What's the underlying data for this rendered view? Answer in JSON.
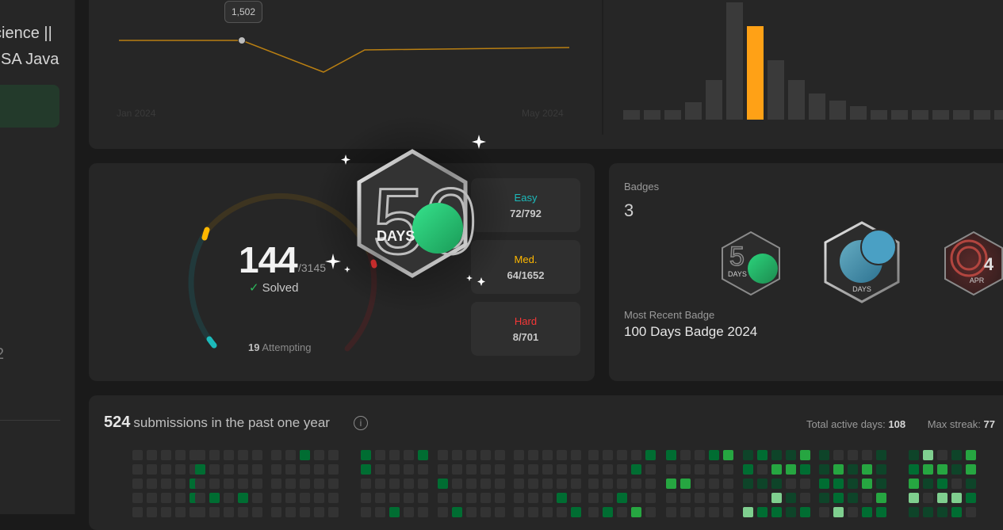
{
  "left_panel": {
    "line1": "cience ||",
    "line2": "SA Java",
    "digit": "2"
  },
  "rating": {
    "tooltip": "1,502",
    "axis_start": "Jan 2024",
    "axis_end": "May 2024"
  },
  "solved": {
    "count": "144",
    "total": "/3145",
    "label": "Solved",
    "attempting_count": "19",
    "attempting_label": "Attempting",
    "easy": {
      "name": "Easy",
      "value": "72/792",
      "color": "#1cbaba"
    },
    "medium": {
      "name": "Med.",
      "value": "64/1652",
      "color": "#ffb800"
    },
    "hard": {
      "name": "Hard",
      "value": "8/701",
      "color": "#f63737"
    }
  },
  "featured_badge": {
    "icon": "50-days-badge-icon",
    "text": "DAYS",
    "number": "50"
  },
  "badges": {
    "title": "Badges",
    "count": "3",
    "items": [
      {
        "icon": "50-days-badge-icon",
        "text": "DAYS"
      },
      {
        "icon": "100-days-badge-icon",
        "text": "DAYS"
      },
      {
        "icon": "april-badge-icon",
        "text": "APR",
        "number": "4"
      }
    ],
    "recent_title": "Most Recent Badge",
    "recent_name": "100 Days Badge 2024"
  },
  "submissions": {
    "count": "524",
    "label": "submissions in the past one year",
    "active_days_label": "Total active days:",
    "active_days": "108",
    "max_streak_label": "Max streak:",
    "max_streak": "77"
  },
  "colors": {
    "accent": "#ffa116",
    "green": "#2cbb5d",
    "card": "#262626",
    "background": "#1a1a1a"
  }
}
